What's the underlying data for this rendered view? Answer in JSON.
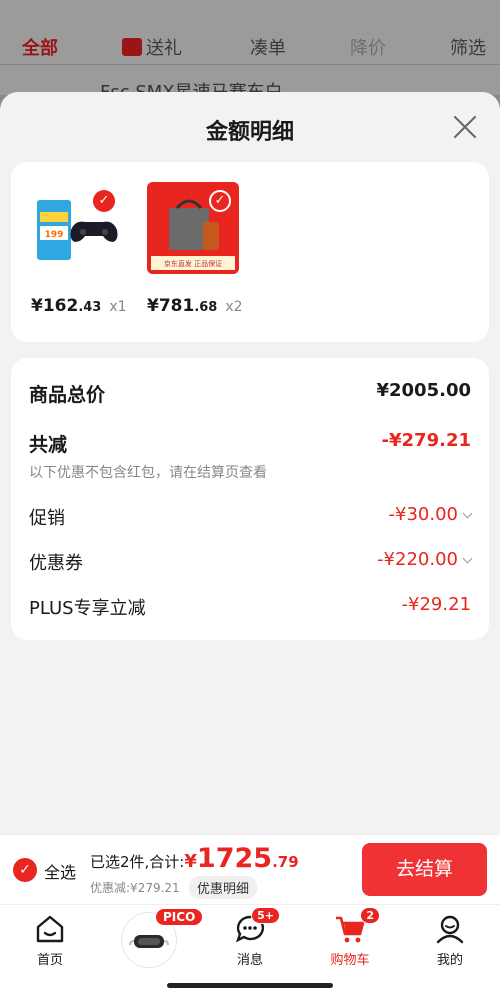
{
  "background": {
    "tabs": [
      "全部",
      "送礼",
      "凑单",
      "降价",
      "筛选"
    ],
    "strip_text": "Fsc SMX星速马赛东白"
  },
  "sheet": {
    "title": "金额明细",
    "products": [
      {
        "price_int": "¥162",
        "price_dec": ".43",
        "qty": "x1",
        "thumb_text": "199"
      },
      {
        "price_int": "¥781",
        "price_dec": ".68",
        "qty": "x2",
        "thumb_text": "京东直发 正品保证"
      }
    ],
    "details": {
      "goods_total_label": "商品总价",
      "goods_total_value": "¥2005.00",
      "total_reduce_label": "共减",
      "total_reduce_value": "-¥279.21",
      "note": "以下优惠不包含红包，请在结算页查看",
      "promo_label": "促销",
      "promo_value": "-¥30.00",
      "coupon_label": "优惠券",
      "coupon_value": "-¥220.00",
      "plus_label": "PLUS专享立减",
      "plus_value": "-¥29.21"
    }
  },
  "checkout": {
    "select_all": "全选",
    "summary_prefix": "已选2件,合计:",
    "currency": "¥",
    "total_int": "1725",
    "total_dec": ".79",
    "discount_text": "优惠减:¥279.21",
    "detail_button": "优惠明细",
    "pay_button": "去结算"
  },
  "tabbar": {
    "items": [
      {
        "label": "首页"
      },
      {
        "label": "PICO"
      },
      {
        "label": "消息",
        "badge": "5+"
      },
      {
        "label": "购物车",
        "badge": "2"
      },
      {
        "label": "我的"
      }
    ]
  },
  "colors": {
    "accent": "#e8261f",
    "pay_button": "#ef3335"
  }
}
